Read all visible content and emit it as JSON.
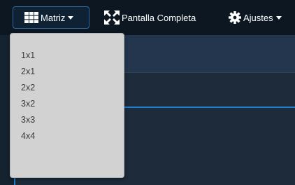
{
  "toolbar": {
    "matriz": {
      "label": "Matriz",
      "icon": "grid-icon"
    },
    "fullscreen": {
      "label": "Pantalla Completa",
      "icon": "expand-arrows-icon"
    },
    "ajustes": {
      "label": "Ajustes",
      "icon": "gear-icon"
    }
  },
  "dropdown": {
    "items": [
      "1x1",
      "2x1",
      "2x2",
      "3x2",
      "3x3",
      "4x4"
    ]
  },
  "colors": {
    "toolbar_bg": "#0c1722",
    "panel_bg": "#1d2b3a",
    "accent": "#1d7fd1",
    "dropdown_bg": "#d2d2d2"
  }
}
